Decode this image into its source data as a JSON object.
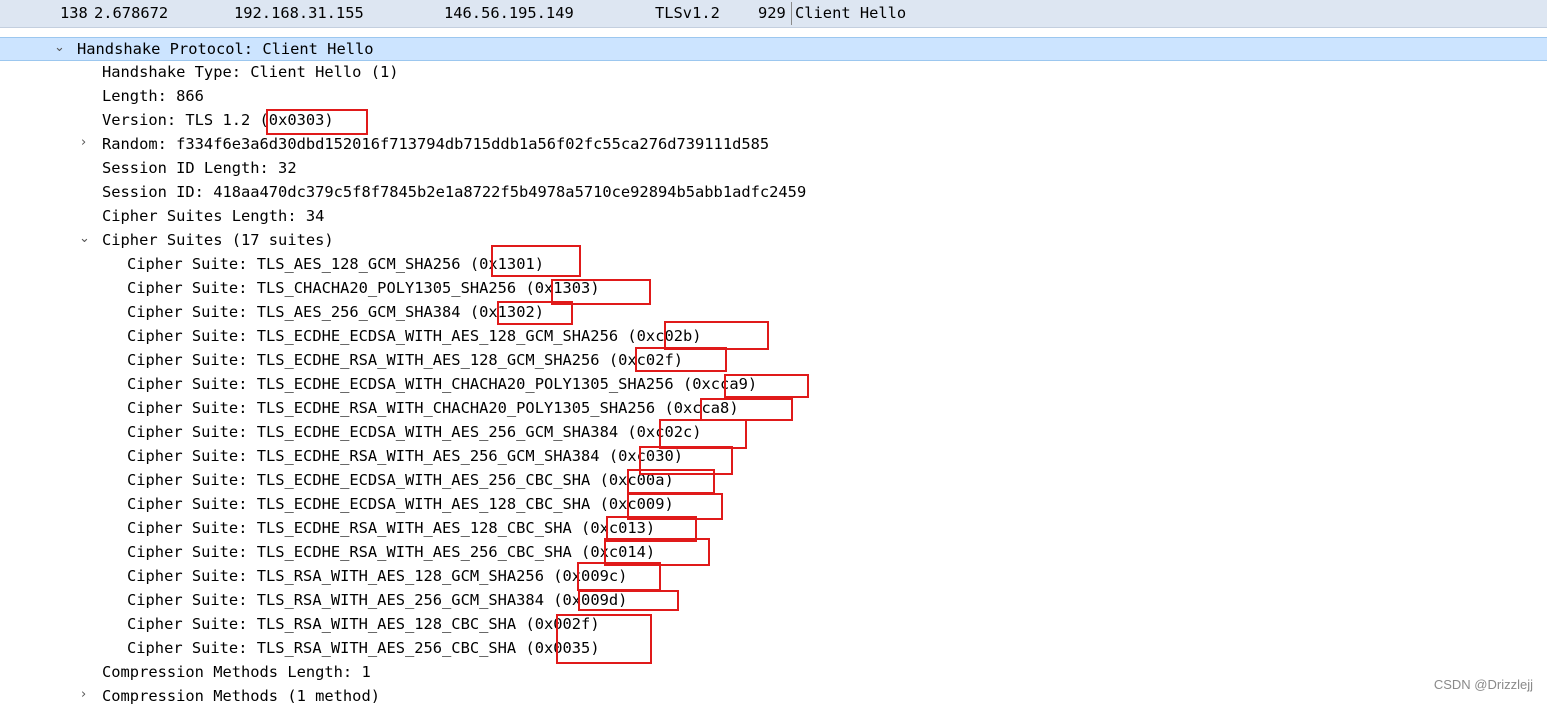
{
  "packet": {
    "number": "138",
    "time": "2.678672",
    "source": "192.168.31.155",
    "destination": "146.56.195.149",
    "protocol": "TLSv1.2",
    "length": "929",
    "info": "Client Hello"
  },
  "tree": {
    "handshake_protocol": "Handshake Protocol: Client Hello",
    "handshake_type": "Handshake Type: Client Hello (1)",
    "length": "Length: 866",
    "version_prefix": "Version: TLS 1.2 ",
    "version_code": "(0x0303)",
    "random": "Random: f334f6e3a6d30dbd152016f713794db715ddb1a56f02fc55ca276d739111d585",
    "session_id_length": "Session ID Length: 32",
    "session_id": "Session ID: 418aa470dc379c5f8f7845b2e1a8722f5b4978a5710ce92894b5abb1adfc2459",
    "cipher_suites_length": "Cipher Suites Length: 34",
    "cipher_suites_header": "Cipher Suites (17 suites)",
    "cipher_suites": [
      {
        "name": "Cipher Suite: TLS_AES_128_GCM_SHA256",
        "code": "(0x1301)"
      },
      {
        "name": "Cipher Suite: TLS_CHACHA20_POLY1305_SHA256",
        "code": "(0x1303)"
      },
      {
        "name": "Cipher Suite: TLS_AES_256_GCM_SHA384",
        "code": "(0x1302)"
      },
      {
        "name": "Cipher Suite: TLS_ECDHE_ECDSA_WITH_AES_128_GCM_SHA256",
        "code": "(0xc02b)"
      },
      {
        "name": "Cipher Suite: TLS_ECDHE_RSA_WITH_AES_128_GCM_SHA256",
        "code": "(0xc02f)"
      },
      {
        "name": "Cipher Suite: TLS_ECDHE_ECDSA_WITH_CHACHA20_POLY1305_SHA256",
        "code": "(0xcca9)"
      },
      {
        "name": "Cipher Suite: TLS_ECDHE_RSA_WITH_CHACHA20_POLY1305_SHA256",
        "code": "(0xcca8)"
      },
      {
        "name": "Cipher Suite: TLS_ECDHE_ECDSA_WITH_AES_256_GCM_SHA384",
        "code": "(0xc02c)"
      },
      {
        "name": "Cipher Suite: TLS_ECDHE_RSA_WITH_AES_256_GCM_SHA384",
        "code": "(0xc030)"
      },
      {
        "name": "Cipher Suite: TLS_ECDHE_ECDSA_WITH_AES_256_CBC_SHA",
        "code": "(0xc00a)"
      },
      {
        "name": "Cipher Suite: TLS_ECDHE_ECDSA_WITH_AES_128_CBC_SHA",
        "code": "(0xc009)"
      },
      {
        "name": "Cipher Suite: TLS_ECDHE_RSA_WITH_AES_128_CBC_SHA",
        "code": "(0xc013)"
      },
      {
        "name": "Cipher Suite: TLS_ECDHE_RSA_WITH_AES_256_CBC_SHA",
        "code": "(0xc014)"
      },
      {
        "name": "Cipher Suite: TLS_RSA_WITH_AES_128_GCM_SHA256",
        "code": "(0x009c)"
      },
      {
        "name": "Cipher Suite: TLS_RSA_WITH_AES_256_GCM_SHA384",
        "code": "(0x009d)"
      },
      {
        "name": "Cipher Suite: TLS_RSA_WITH_AES_128_CBC_SHA",
        "code": "(0x002f)"
      },
      {
        "name": "Cipher Suite: TLS_RSA_WITH_AES_256_CBC_SHA",
        "code": "(0x0035)"
      }
    ],
    "compression_methods_length": "Compression Methods Length: 1",
    "compression_methods": "Compression Methods (1 method)"
  },
  "watermark": "CSDN @Drizzlejj",
  "colors": {
    "packet_row_bg": "#dde6f2",
    "selected_bg": "#cce4ff",
    "highlight_box": "#e01a1a"
  }
}
